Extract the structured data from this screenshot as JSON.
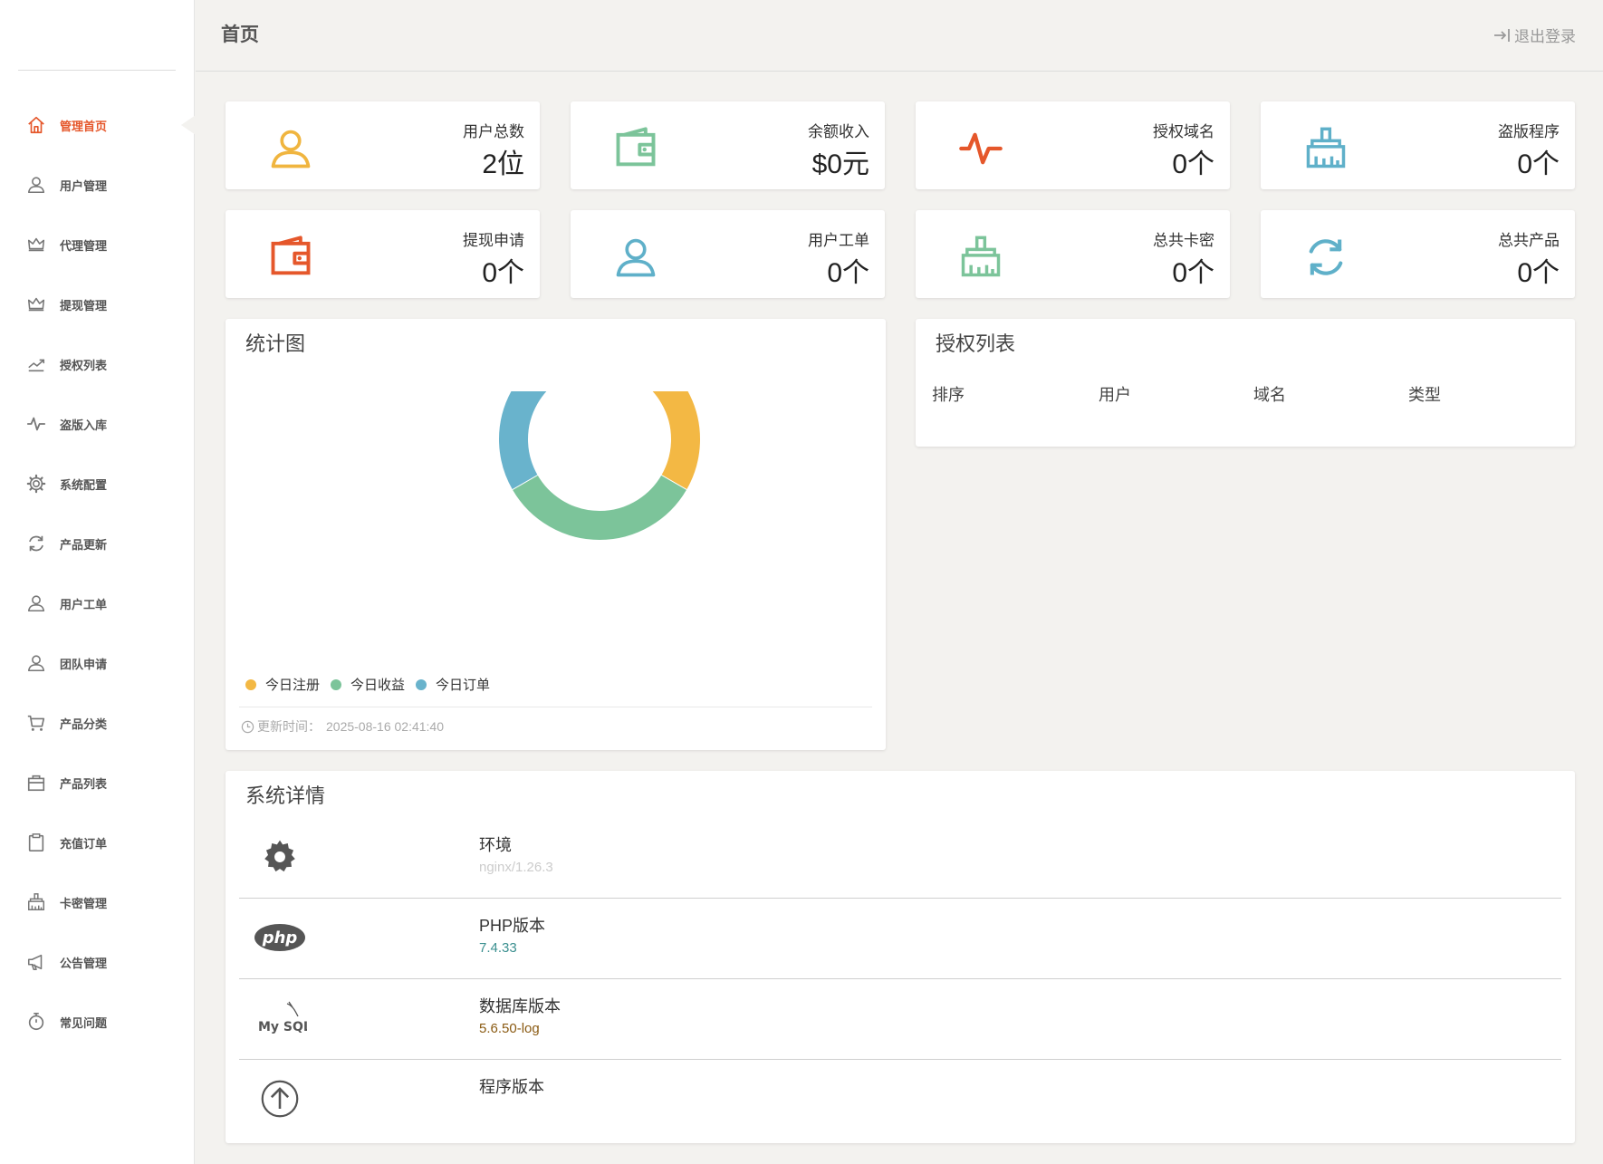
{
  "sidebar": {
    "items": [
      {
        "label": "管理首页",
        "icon": "home-icon",
        "active": true
      },
      {
        "label": "用户管理",
        "icon": "user-icon"
      },
      {
        "label": "代理管理",
        "icon": "crown-icon"
      },
      {
        "label": "提现管理",
        "icon": "crown-icon"
      },
      {
        "label": "授权列表",
        "icon": "trend-icon"
      },
      {
        "label": "盗版入库",
        "icon": "pulse-icon"
      },
      {
        "label": "系统配置",
        "icon": "gear-icon"
      },
      {
        "label": "产品更新",
        "icon": "refresh-icon"
      },
      {
        "label": "用户工单",
        "icon": "user-icon"
      },
      {
        "label": "团队申请",
        "icon": "user-icon"
      },
      {
        "label": "产品分类",
        "icon": "cart-icon"
      },
      {
        "label": "产品列表",
        "icon": "bag-icon"
      },
      {
        "label": "充值订单",
        "icon": "clipboard-icon"
      },
      {
        "label": "卡密管理",
        "icon": "broom-icon"
      },
      {
        "label": "公告管理",
        "icon": "megaphone-icon"
      },
      {
        "label": "常见问题",
        "icon": "stopwatch-icon"
      }
    ]
  },
  "header": {
    "title": "首页",
    "logout_label": "退出登录"
  },
  "stats": [
    {
      "label": "用户总数",
      "value": "2位",
      "icon": "user-icon",
      "color": "#f0b53f"
    },
    {
      "label": "余额收入",
      "value": "$0元",
      "icon": "wallet-icon",
      "color": "#7cc49a"
    },
    {
      "label": "授权域名",
      "value": "0个",
      "icon": "pulse-icon",
      "color": "#e5572b"
    },
    {
      "label": "盗版程序",
      "value": "0个",
      "icon": "broom-icon",
      "color": "#5fb0c9"
    },
    {
      "label": "提现申请",
      "value": "0个",
      "icon": "wallet-icon",
      "color": "#e5572b"
    },
    {
      "label": "用户工单",
      "value": "0个",
      "icon": "user-icon",
      "color": "#5fb0c9"
    },
    {
      "label": "总共卡密",
      "value": "0个",
      "icon": "broom-icon",
      "color": "#7cc49a"
    },
    {
      "label": "总共产品",
      "value": "0个",
      "icon": "refresh-icon",
      "color": "#5fb0c9"
    }
  ],
  "chart": {
    "title": "统计图",
    "update_label": "更新时间：",
    "update_time": "2025-08-16 02:41:40"
  },
  "chart_data": {
    "type": "pie",
    "donut": true,
    "categories": [
      "今日注册",
      "今日收益",
      "今日订单"
    ],
    "values": [
      1,
      1,
      1
    ],
    "colors": [
      "#f3b844",
      "#7cc49a",
      "#69b3cc"
    ],
    "legend": "bottom-left"
  },
  "auth_list": {
    "title": "授权列表",
    "columns": [
      "排序",
      "用户",
      "域名",
      "类型"
    ]
  },
  "system": {
    "title": "系统详情",
    "rows": [
      {
        "label": "环境",
        "value": "nginx/1.26.3",
        "icon": "gear-icon",
        "value_color": "#cccccc"
      },
      {
        "label": "PHP版本",
        "value": "7.4.33",
        "icon": "php-logo",
        "value_color": "#3a8f8f"
      },
      {
        "label": "数据库版本",
        "value": "5.6.50-log",
        "icon": "mysql-logo",
        "value_color": "#8a5a12"
      },
      {
        "label": "程序版本",
        "value": "",
        "icon": "upload-icon",
        "value_color": "#333333"
      }
    ]
  }
}
